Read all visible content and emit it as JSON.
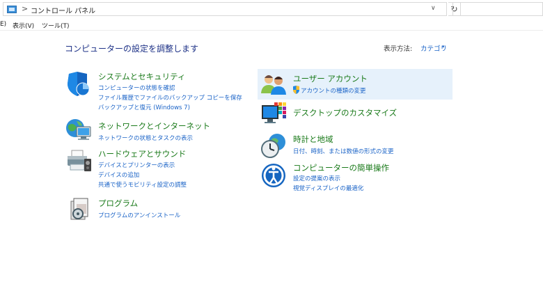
{
  "address_bar": {
    "breadcrumb_separator": ">",
    "location": "コントロール パネル",
    "dropdown_icon": "chevron-down-icon",
    "refresh_icon": "refresh-icon",
    "refresh_glyph": "↻",
    "dropdown_glyph": "∨"
  },
  "menu": {
    "items": [
      "E)",
      "表示(V)",
      "ツール(T)"
    ]
  },
  "header": {
    "title": "コンピューターの設定を調整します",
    "view_label": "表示方法:",
    "view_value": "カテゴリ",
    "view_caret": "▾"
  },
  "categories": {
    "system_security": {
      "title": "システムとセキュリティ",
      "links": [
        "コンピューターの状態を確認",
        "ファイル履歴でファイルのバックアップ コピーを保存",
        "バックアップと復元 (Windows 7)"
      ],
      "icon": "shield-icon"
    },
    "network": {
      "title": "ネットワークとインターネット",
      "links": [
        "ネットワークの状態とタスクの表示"
      ],
      "icon": "network-globe-icon"
    },
    "hardware": {
      "title": "ハードウェアとサウンド",
      "links": [
        "デバイスとプリンターの表示",
        "デバイスの追加",
        "共通で使うモビリティ設定の調整"
      ],
      "icon": "printer-icon"
    },
    "programs": {
      "title": "プログラム",
      "links": [
        "プログラムのアンインストール"
      ],
      "icon": "programs-icon"
    },
    "user_accounts": {
      "title": "ユーザー アカウント",
      "links": [
        "アカウントの種類の変更"
      ],
      "icon": "users-icon",
      "link_icon": "uac-shield-icon"
    },
    "desktop": {
      "title": "デスクトップのカスタマイズ",
      "links": [],
      "icon": "desktop-icon"
    },
    "clock_region": {
      "title": "時計と地域",
      "links": [
        "日付、時刻、または数値の形式の変更"
      ],
      "icon": "clock-globe-icon"
    },
    "ease_of_access": {
      "title": "コンピューターの簡単操作",
      "links": [
        "設定の提案の表示",
        "視覚ディスプレイの最適化"
      ],
      "icon": "ease-of-access-icon"
    }
  },
  "colors": {
    "category_title": "#1a7a1a",
    "link": "#1a63c7",
    "page_title": "#1e3287",
    "hover_highlight": "#e6f1fb"
  }
}
